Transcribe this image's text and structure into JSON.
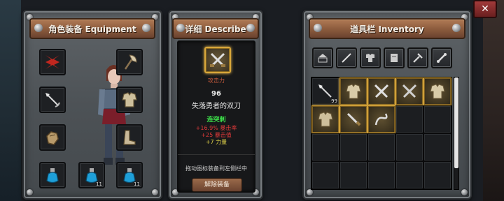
{
  "equipment": {
    "title": "角色装备 Equipment",
    "slots": [
      {
        "name": "red-rune",
        "count": ""
      },
      {
        "name": "axe",
        "count": ""
      },
      {
        "name": "arrow",
        "count": ""
      },
      {
        "name": "chest-armor",
        "count": ""
      },
      {
        "name": "gauntlet",
        "count": ""
      },
      {
        "name": "boots",
        "count": ""
      },
      {
        "name": "potion",
        "count": ""
      },
      {
        "name": "potion",
        "count": "11"
      },
      {
        "name": "potion",
        "count": "11"
      }
    ]
  },
  "describe": {
    "title": "详细 Describe",
    "attr_label": "攻击力",
    "value": "96",
    "item_name": "失落勇者的双刀",
    "skill": "连突刺",
    "stats": [
      "+16.9% 暴击率",
      "+25 暴击值",
      "+7 力量"
    ],
    "hint": "拖动图标装备到左侧栏中",
    "unequip_label": "解除装备"
  },
  "inventory": {
    "title": "道具栏 Inventory",
    "filters": [
      "all-icon",
      "sword-filter-icon",
      "armor-filter-icon",
      "scroll-filter-icon",
      "tools-filter-icon",
      "bone-filter-icon"
    ],
    "items": [
      {
        "name": "arrow",
        "count": "99"
      },
      {
        "name": "chest-armor",
        "count": ""
      },
      {
        "name": "dual-swords",
        "count": ""
      },
      {
        "name": "dual-swords",
        "count": ""
      },
      {
        "name": "chest-armor",
        "count": ""
      },
      {
        "name": "chest-armor",
        "count": ""
      },
      {
        "name": "dagger",
        "count": ""
      },
      {
        "name": "whip",
        "count": ""
      }
    ]
  },
  "close_label": "✕",
  "colors": {
    "gold": "#d8a63a",
    "green": "#3de34a",
    "red": "#e33a3a",
    "yellow": "#e0d24a"
  }
}
